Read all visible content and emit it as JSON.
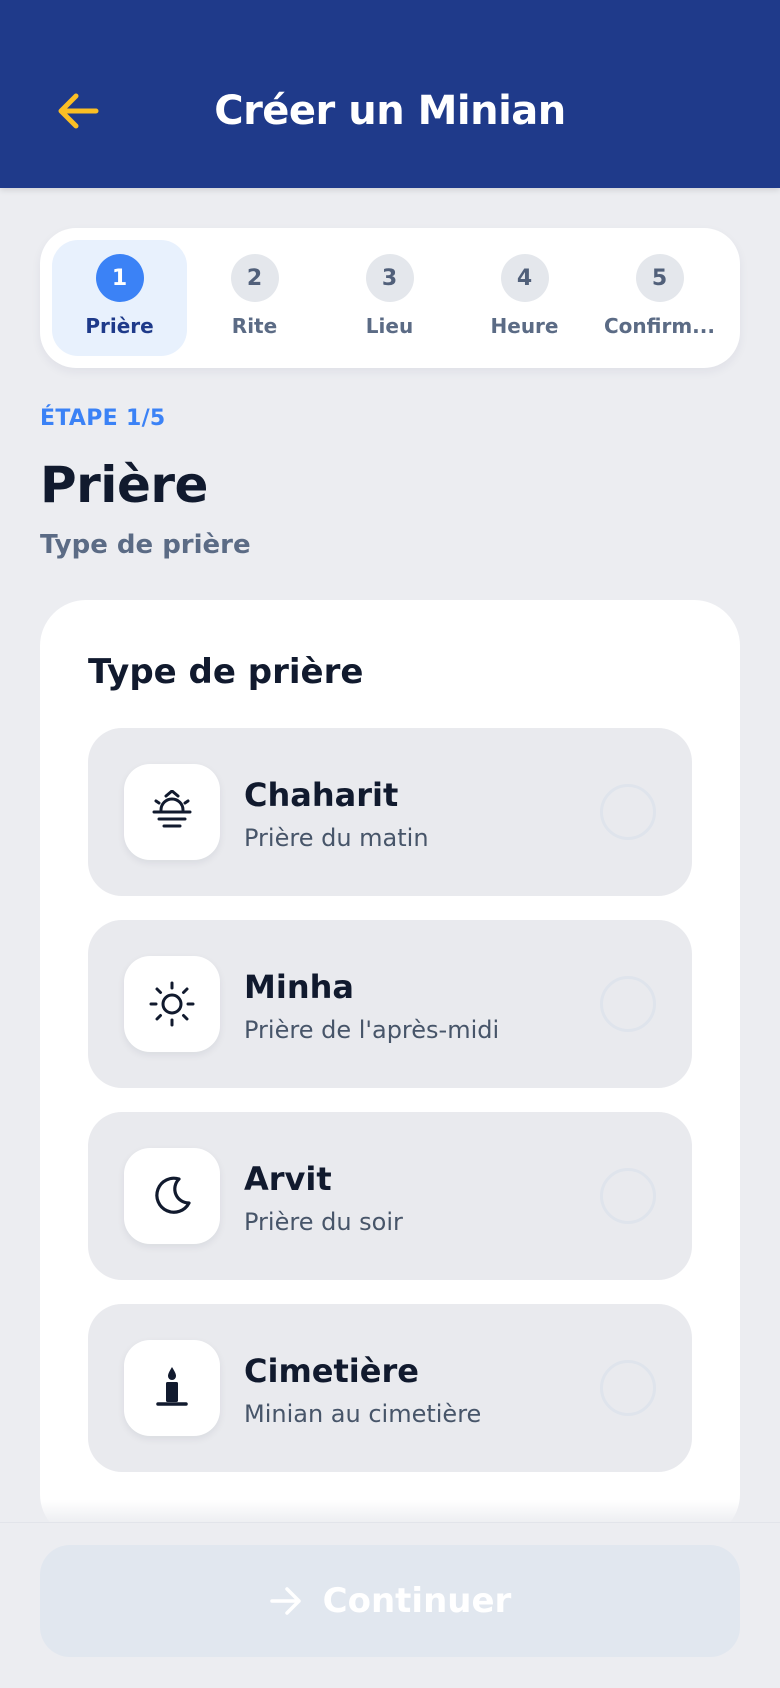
{
  "header": {
    "title": "Créer un Minian",
    "back_icon": "arrow-left-icon",
    "accent_color": "#fbbf24",
    "background_color": "#1f3a8a"
  },
  "stepper": {
    "active_index": 0,
    "steps": [
      {
        "number": "1",
        "label": "Prière"
      },
      {
        "number": "2",
        "label": "Rite"
      },
      {
        "number": "3",
        "label": "Lieu"
      },
      {
        "number": "4",
        "label": "Heure"
      },
      {
        "number": "5",
        "label": "Confirm..."
      }
    ]
  },
  "step_heading": {
    "indicator": "ÉTAPE 1/5",
    "title": "Prière",
    "subtitle": "Type de prière"
  },
  "card": {
    "title": "Type de prière",
    "options": [
      {
        "title": "Chaharit",
        "description": "Prière du matin",
        "icon": "sunrise-icon",
        "selected": false
      },
      {
        "title": "Minha",
        "description": "Prière de l'après-midi",
        "icon": "sun-icon",
        "selected": false
      },
      {
        "title": "Arvit",
        "description": "Prière du soir",
        "icon": "moon-icon",
        "selected": false
      },
      {
        "title": "Cimetière",
        "description": "Minian au cimetière",
        "icon": "candle-icon",
        "selected": false
      }
    ]
  },
  "footer": {
    "continue_label": "Continuer",
    "continue_icon": "arrow-right-icon",
    "disabled": true
  }
}
